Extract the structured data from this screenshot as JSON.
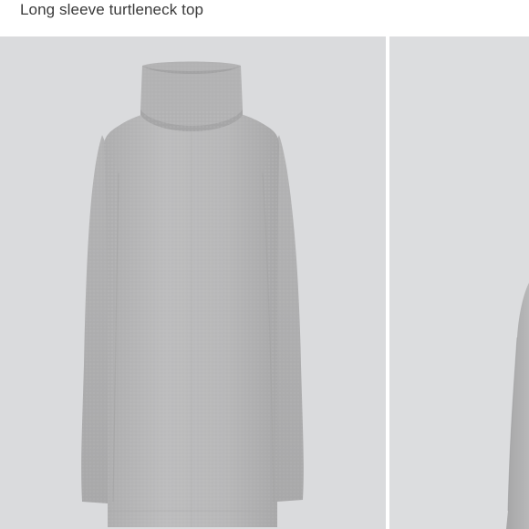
{
  "product": {
    "title": "Long sleeve turtleneck top"
  },
  "gallery": {
    "images": [
      {
        "alt": "",
        "icon": "turtleneck-top-image"
      },
      {
        "alt": "",
        "icon": "turtleneck-top-image-partial"
      }
    ],
    "colors": {
      "background": "#dadbdd",
      "garment": "#b9b9ba",
      "garment_shadow": "#a9a9aa"
    }
  }
}
